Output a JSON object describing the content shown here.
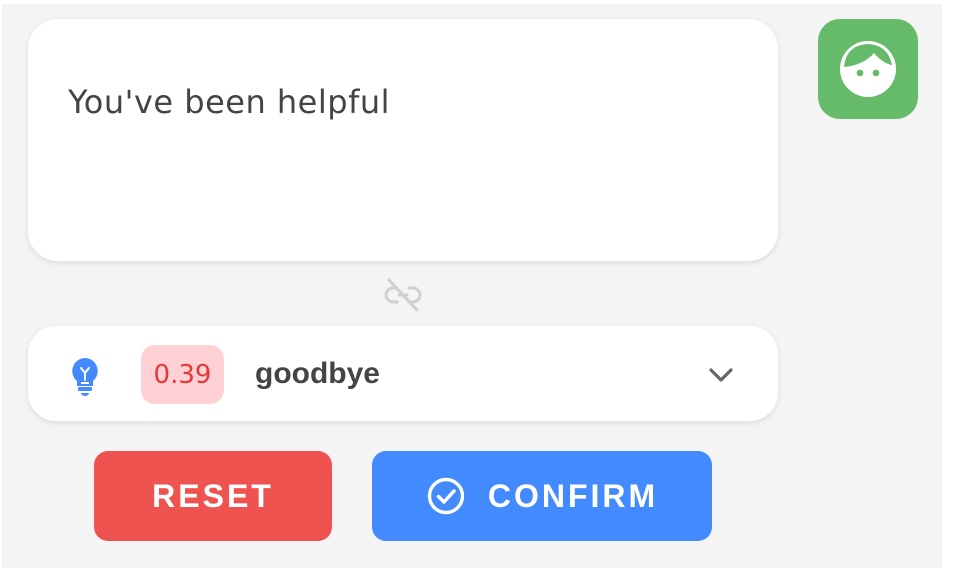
{
  "message": {
    "text": "You've been helpful"
  },
  "avatar": {
    "icon": "face-icon",
    "color": "#66bb6a"
  },
  "link_status": {
    "icon": "unlink-icon"
  },
  "intent": {
    "icon": "lightbulb-icon",
    "score": "0.39",
    "name": "goodbye",
    "expand_icon": "chevron-down-icon"
  },
  "actions": {
    "reset_label": "RESET",
    "confirm_label": "CONFIRM",
    "confirm_icon": "check-circle-icon"
  },
  "colors": {
    "reset": "#ef5350",
    "confirm": "#448aff",
    "score_bg": "#ffd0d4",
    "score_text": "#e53935",
    "bulb": "#448aff"
  }
}
